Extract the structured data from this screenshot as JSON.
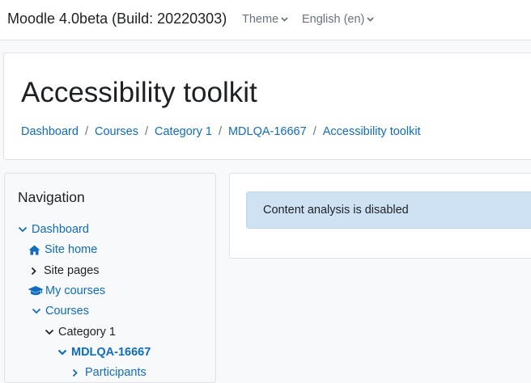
{
  "navbar": {
    "brand": "Moodle 4.0beta (Build: 20220303)",
    "theme_label": "Theme",
    "language_label": "English (en)"
  },
  "header": {
    "title": "Accessibility toolkit",
    "breadcrumb": [
      "Dashboard",
      "Courses",
      "Category 1",
      "MDLQA-16667",
      "Accessibility toolkit"
    ]
  },
  "navigation": {
    "title": "Navigation",
    "items": [
      {
        "label": "Dashboard",
        "icon": "chevron-down-icon"
      },
      {
        "label": "Site home",
        "icon": "home-icon"
      },
      {
        "label": "Site pages",
        "icon": "chevron-right-icon"
      },
      {
        "label": "My courses",
        "icon": "graduation-cap-icon"
      },
      {
        "label": "Courses",
        "icon": "chevron-down-icon"
      },
      {
        "label": "Category 1",
        "icon": "chevron-down-icon"
      },
      {
        "label": "MDLQA-16667",
        "icon": "chevron-down-icon"
      },
      {
        "label": "Participants",
        "icon": "chevron-right-icon"
      }
    ]
  },
  "main": {
    "alert_text": "Content analysis is disabled"
  },
  "colors": {
    "link": "#0f6cbf",
    "alert_bg": "#cfe2f3",
    "text": "#1d2125",
    "muted": "#6a737b"
  }
}
